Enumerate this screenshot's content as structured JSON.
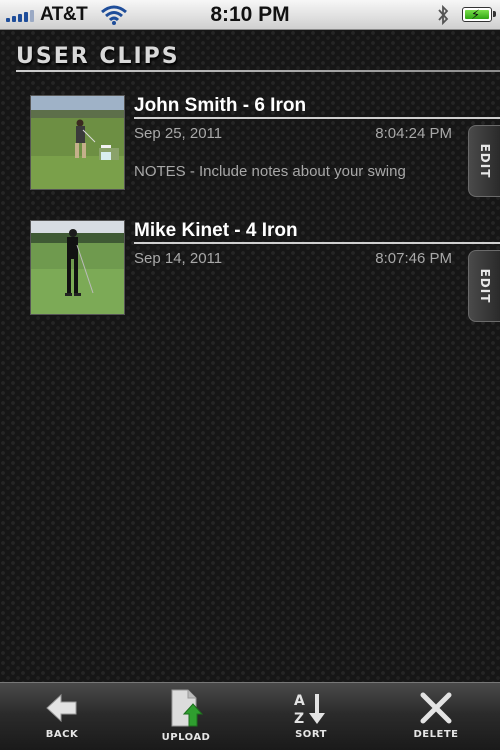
{
  "status_bar": {
    "carrier": "AT&T",
    "time": "8:10 PM",
    "signal_icon": "signal-bars-icon",
    "wifi_icon": "wifi-icon",
    "bluetooth_icon": "bluetooth-icon",
    "battery_icon": "battery-charging-icon",
    "battery_color": "#3fbf1d"
  },
  "header": {
    "title": "USER CLIPS"
  },
  "clips": [
    {
      "title": "John Smith - 6 Iron",
      "date": "Sep 25, 2011",
      "time": "8:04:24 PM",
      "notes": "NOTES - Include notes about your swing",
      "edit_label": "EDIT"
    },
    {
      "title": "Mike Kinet - 4 Iron",
      "date": "Sep 14, 2011",
      "time": "8:07:46 PM",
      "notes": "",
      "edit_label": "EDIT"
    }
  ],
  "toolbar": {
    "back_label": "BACK",
    "upload_label": "UPLOAD",
    "sort_label": "SORT",
    "delete_label": "DELETE",
    "back_icon": "back-arrow-icon",
    "upload_icon": "upload-icon",
    "sort_icon": "sort-az-icon",
    "delete_icon": "delete-x-icon",
    "upload_accent": "#2f9e2f"
  }
}
